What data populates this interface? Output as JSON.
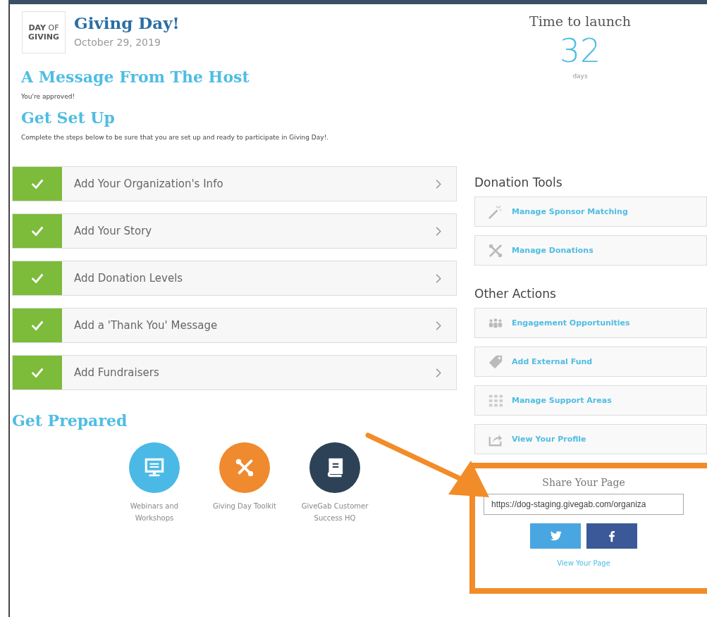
{
  "header": {
    "logo": [
      "DAY",
      "OF",
      "GIVING"
    ],
    "title": "Giving Day!",
    "date": "October 29, 2019"
  },
  "host": {
    "heading": "A Message From The Host",
    "message": "You're approved!"
  },
  "setup": {
    "heading": "Get Set Up",
    "intro": "Complete the steps below to be sure that you are set up and ready to participate in Giving Day!.",
    "steps": [
      {
        "label": "Add Your Organization's Info",
        "checked": true
      },
      {
        "label": "Add Your Story",
        "checked": true
      },
      {
        "label": "Add Donation Levels",
        "checked": true
      },
      {
        "label": "Add a 'Thank You' Message",
        "checked": true
      },
      {
        "label": "Add Fundraisers",
        "checked": true
      }
    ]
  },
  "prepared": {
    "heading": "Get Prepared",
    "resources": [
      {
        "label": "Webinars and Workshops",
        "kind": "monitor",
        "color": "#4bb9e6"
      },
      {
        "label": "Giving Day Toolkit",
        "kind": "tools",
        "color": "#ef8a2e"
      },
      {
        "label": "GiveGab Customer Success HQ",
        "kind": "book",
        "color": "#2d4256"
      }
    ]
  },
  "countdown": {
    "title": "Time to launch",
    "value": "32",
    "unit": "days"
  },
  "donation_tools": {
    "heading": "Donation Tools",
    "items": [
      {
        "label": "Manage Sponsor Matching",
        "kind": "wand"
      },
      {
        "label": "Manage Donations",
        "kind": "tools"
      }
    ]
  },
  "other_actions": {
    "heading": "Other Actions",
    "items": [
      {
        "label": "Engagement Opportunities",
        "kind": "people"
      },
      {
        "label": "Add External Fund",
        "kind": "tag"
      },
      {
        "label": "Manage Support Areas",
        "kind": "grid"
      },
      {
        "label": "View Your Profile",
        "kind": "share"
      }
    ]
  },
  "share": {
    "heading": "Share Your Page",
    "url": "https://dog-staging.givegab.com/organiza",
    "link": "View Your Page"
  }
}
